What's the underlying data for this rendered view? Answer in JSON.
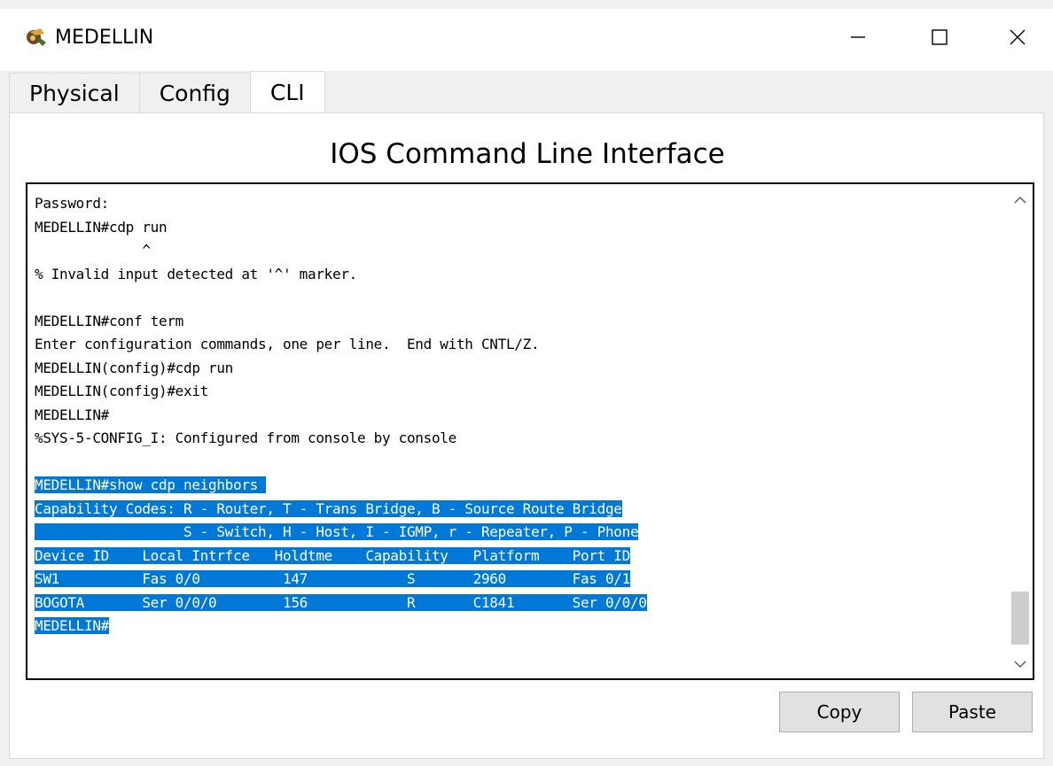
{
  "window": {
    "title": "MEDELLIN",
    "controls": [
      "minimize-icon",
      "maximize-icon",
      "close-icon"
    ]
  },
  "tabs": [
    {
      "label": "Physical",
      "active": false
    },
    {
      "label": "Config",
      "active": false
    },
    {
      "label": "CLI",
      "active": true
    }
  ],
  "panel": {
    "title": "IOS Command Line Interface"
  },
  "terminal": {
    "lines": [
      {
        "text": "Password:",
        "selected": false
      },
      {
        "text": "MEDELLIN#cdp run",
        "selected": false
      },
      {
        "text": "             ^",
        "selected": false
      },
      {
        "text": "% Invalid input detected at '^' marker.",
        "selected": false
      },
      {
        "text": "",
        "selected": false
      },
      {
        "text": "MEDELLIN#conf term",
        "selected": false
      },
      {
        "text": "Enter configuration commands, one per line.  End with CNTL/Z.",
        "selected": false
      },
      {
        "text": "MEDELLIN(config)#cdp run",
        "selected": false
      },
      {
        "text": "MEDELLIN(config)#exit",
        "selected": false
      },
      {
        "text": "MEDELLIN#",
        "selected": false
      },
      {
        "text": "%SYS-5-CONFIG_I: Configured from console by console",
        "selected": false
      },
      {
        "text": "",
        "selected": false
      },
      {
        "text": "MEDELLIN#show cdp neighbors ",
        "selected": true
      },
      {
        "text": "Capability Codes: R - Router, T - Trans Bridge, B - Source Route Bridge",
        "selected": true
      },
      {
        "text": "                  S - Switch, H - Host, I - IGMP, r - Repeater, P - Phone",
        "selected": true
      },
      {
        "text": "Device ID    Local Intrfce   Holdtme    Capability   Platform    Port ID",
        "selected": true
      },
      {
        "text": "SW1          Fas 0/0          147            S       2960        Fas 0/1",
        "selected": true
      },
      {
        "text": "BOGOTA       Ser 0/0/0        156            R       C1841       Ser 0/0/0",
        "selected": true
      },
      {
        "text": "MEDELLIN#",
        "selected": true
      }
    ]
  },
  "buttons": {
    "copy": "Copy",
    "paste": "Paste"
  },
  "colors": {
    "selection": "#0078d7",
    "panel_bg": "#ffffff",
    "window_bg": "#f0f0f0"
  }
}
